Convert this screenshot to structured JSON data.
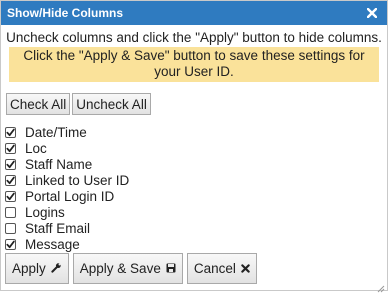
{
  "dialog": {
    "title": "Show/Hide Columns",
    "close_icon": "close-icon"
  },
  "instructions": {
    "line1": "Uncheck columns and click the \"Apply\" button to hide columns.",
    "line2": "Click the \"Apply & Save\" button to save these settings for your User ID."
  },
  "toolbar": {
    "check_all": "Check All",
    "uncheck_all": "Uncheck All"
  },
  "columns": [
    {
      "label": "Date/Time",
      "checked": true
    },
    {
      "label": "Loc",
      "checked": true
    },
    {
      "label": "Staff Name",
      "checked": true
    },
    {
      "label": "Linked to User ID",
      "checked": true
    },
    {
      "label": "Portal Login ID",
      "checked": true
    },
    {
      "label": "Logins",
      "checked": false
    },
    {
      "label": "Staff Email",
      "checked": false
    },
    {
      "label": "Message",
      "checked": true
    }
  ],
  "footer": {
    "apply": "Apply",
    "apply_icon": "wrench-icon",
    "apply_save": "Apply & Save",
    "apply_save_icon": "save-icon",
    "cancel": "Cancel",
    "cancel_icon": "close-icon"
  },
  "colors": {
    "titlebar": "#2f7bc0",
    "highlight": "#fae29a"
  }
}
